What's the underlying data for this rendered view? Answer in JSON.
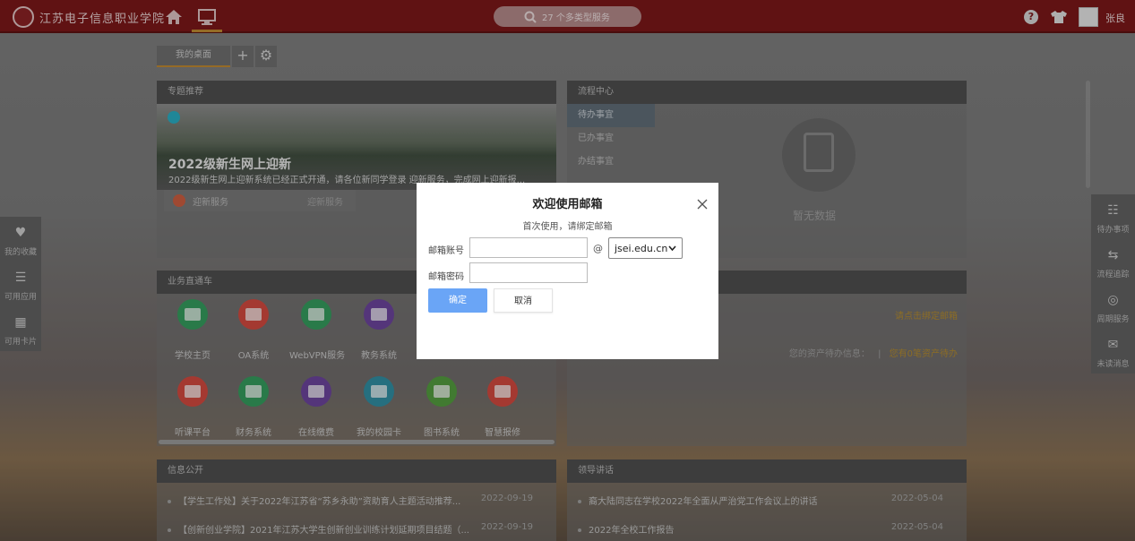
{
  "topbar": {
    "school_name": "江苏电子信息职业学院",
    "search_placeholder": "27 个多类型服务",
    "username": "张良"
  },
  "desk": {
    "tab_label": "我的桌面",
    "add_label": "+",
    "settings_label": "⚙"
  },
  "special": {
    "header": "专题推荐",
    "banner_title": "2022级新生网上迎新",
    "banner_sub": "2022级新生网上迎新系统已经正式开通，请各位新同学登录 迎新服务，完成网上迎新报...",
    "service_left": "迎新服务",
    "service_right": "迎新服务"
  },
  "flow": {
    "header": "流程中心",
    "items": [
      "待办事宜",
      "已办事宜",
      "办结事宜"
    ],
    "empty_text": "暂无数据"
  },
  "business": {
    "header": "业务直通车",
    "items": [
      {
        "label": "学校主页",
        "color": "#2f9e5a"
      },
      {
        "label": "OA系统",
        "color": "#d8453a"
      },
      {
        "label": "WebVPN服务",
        "color": "#2f9e5a"
      },
      {
        "label": "教务系统",
        "color": "#6a3f9e"
      },
      {
        "label": "听课平台",
        "color": "#d8453a"
      },
      {
        "label": "财务系统",
        "color": "#2f9e5a"
      },
      {
        "label": "在线缴费",
        "color": "#6a3f9e"
      },
      {
        "label": "我的校园卡",
        "color": "#2a8fa6"
      },
      {
        "label": "图书系统",
        "color": "#4f9e3a"
      },
      {
        "label": "智慧报修",
        "color": "#d8453a"
      }
    ]
  },
  "personal": {
    "mail_tip": "请点击绑定邮箱",
    "asset_prefix": "您的资产待办信息：",
    "asset_sep": "|",
    "asset_link": "您有0笔资产待办"
  },
  "info": {
    "header": "信息公开",
    "items": [
      {
        "title": "【学生工作处】关于2022年江苏省“苏乡永助”资助育人主题活动推荐...",
        "date": "2022-09-19"
      },
      {
        "title": "【创新创业学院】2021年江苏大学生创新创业训练计划延期项目结题（...",
        "date": "2022-09-19"
      }
    ]
  },
  "speech": {
    "header": "领导讲话",
    "items": [
      {
        "title": "裔大陆同志在学校2022年全面从严治党工作会议上的讲话",
        "date": "2022-05-04"
      },
      {
        "title": "2022年全校工作报告",
        "date": "2022-05-04"
      }
    ]
  },
  "left_dock": {
    "items": [
      {
        "label": "我的收藏",
        "glyph": "♥"
      },
      {
        "label": "可用应用",
        "glyph": "☰"
      },
      {
        "label": "可用卡片",
        "glyph": "▦"
      }
    ]
  },
  "right_dock": {
    "items": [
      {
        "label": "待办事项",
        "glyph": "☷"
      },
      {
        "label": "流程追踪",
        "glyph": "⇆"
      },
      {
        "label": "周期服务",
        "glyph": "◎"
      },
      {
        "label": "未读消息",
        "glyph": "✉"
      }
    ]
  },
  "modal": {
    "title": "欢迎使用邮箱",
    "subtitle": "首次使用，请绑定邮箱",
    "account_label": "邮箱账号",
    "account_value": "",
    "at": "@",
    "domain_selected": "jsei.edu.cn",
    "password_label": "邮箱密码",
    "password_value": "",
    "ok_label": "确定",
    "cancel_label": "取消"
  }
}
